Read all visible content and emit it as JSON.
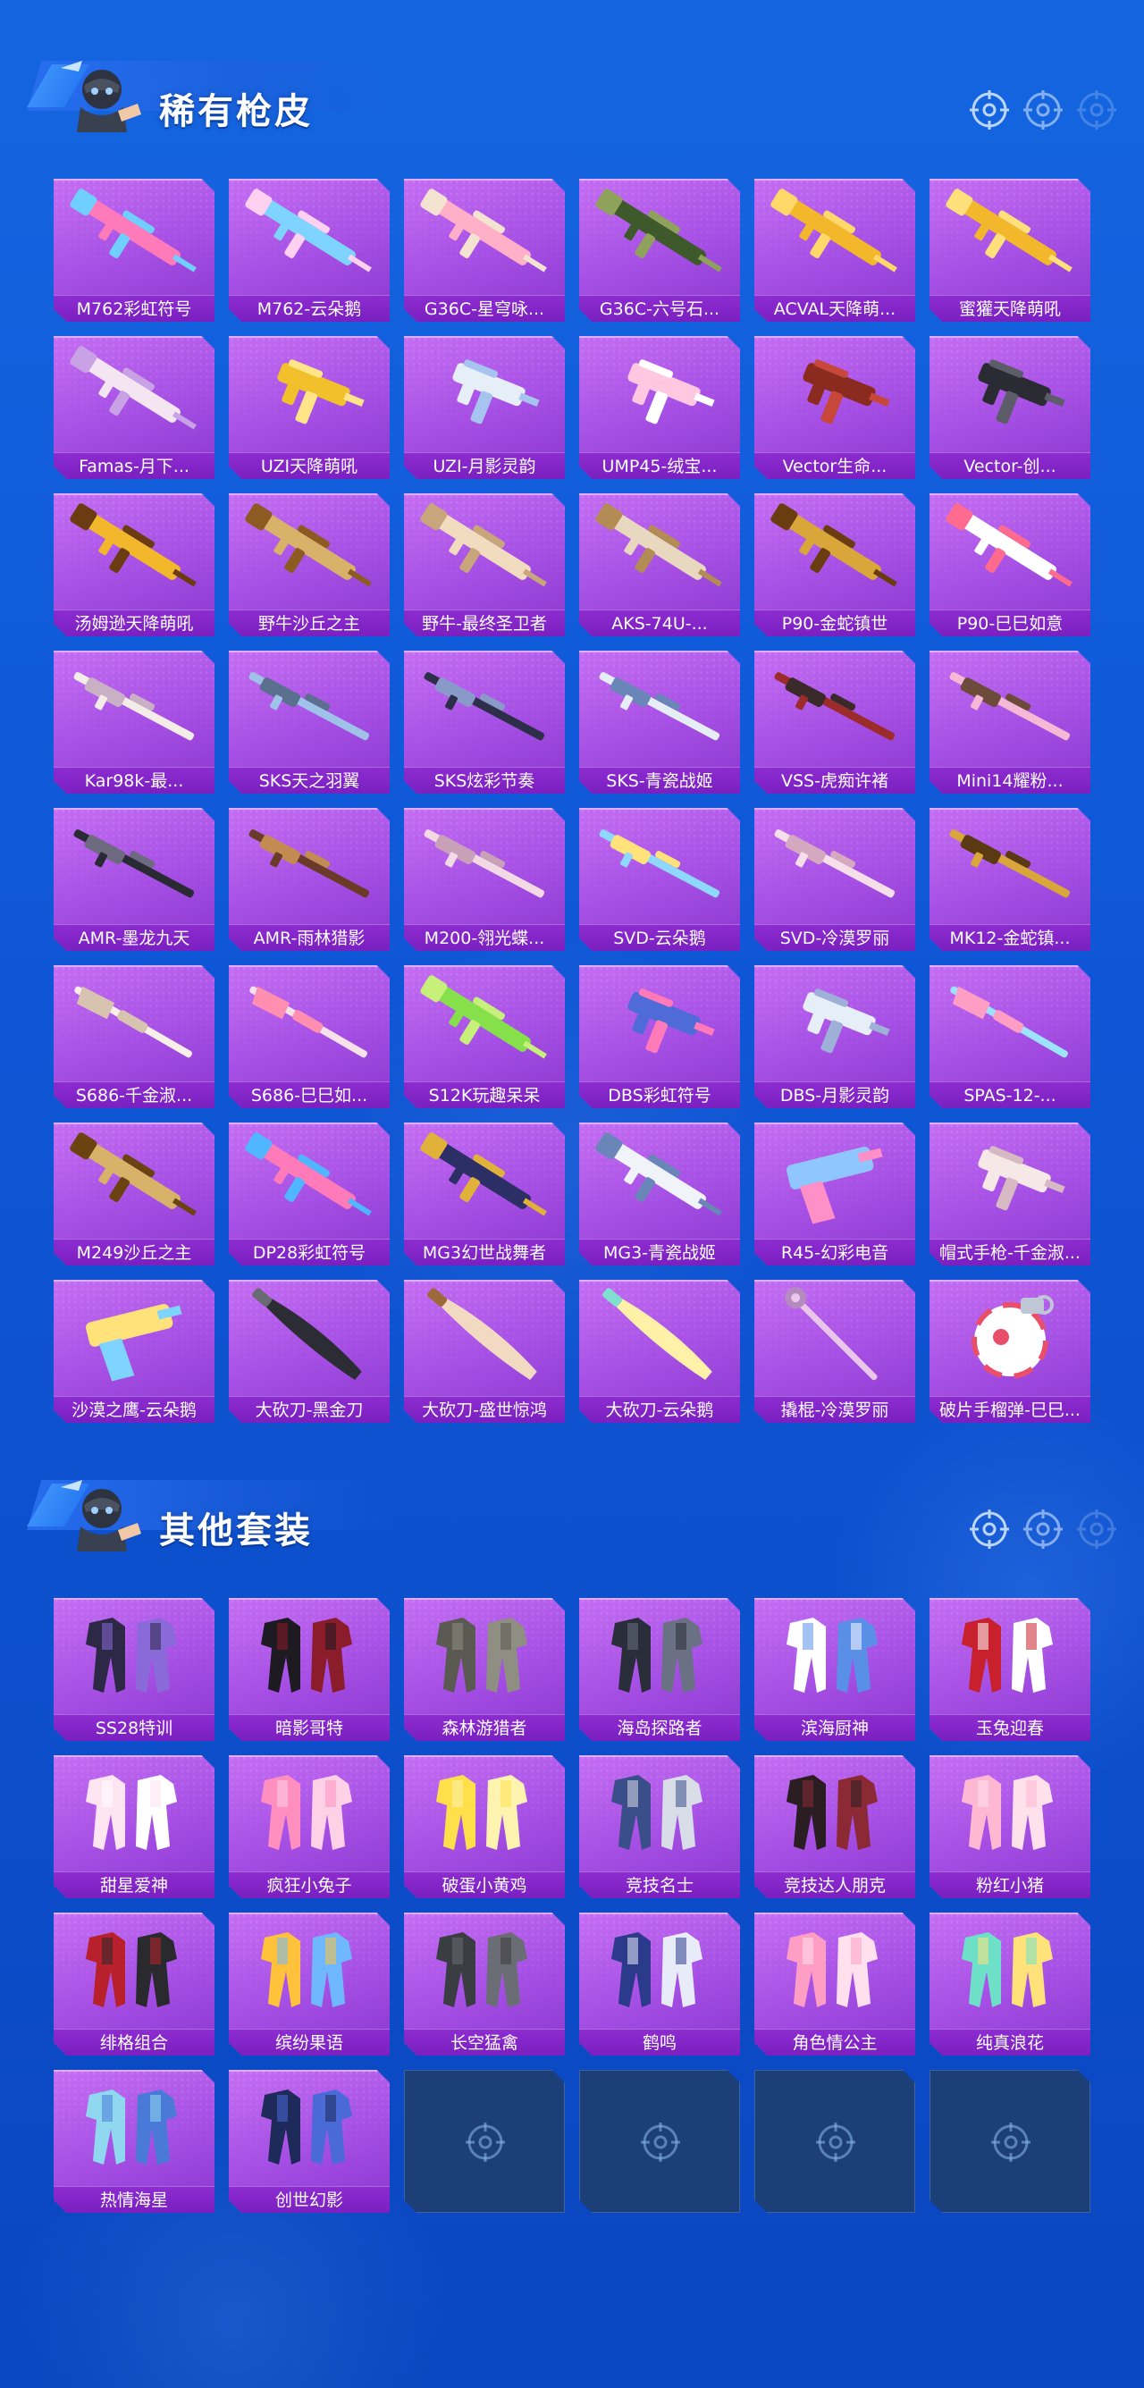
{
  "sections": [
    {
      "title": "稀有枪皮",
      "items": [
        {
          "label": "M762彩虹符号",
          "art": "gun",
          "c1": "#ff7ab8",
          "c2": "#6fd0ff"
        },
        {
          "label": "M762-云朵鹅",
          "art": "gun",
          "c1": "#7fd3ff",
          "c2": "#ffd1f0"
        },
        {
          "label": "G36C-星穹咏...",
          "art": "gun",
          "c1": "#ffb0c8",
          "c2": "#f4e3d0"
        },
        {
          "label": "G36C-六号石...",
          "art": "gun",
          "c1": "#3f5a2a",
          "c2": "#8ea25c"
        },
        {
          "label": "ACVAL天降萌...",
          "art": "gun",
          "c1": "#f2b72a",
          "c2": "#ffd86a"
        },
        {
          "label": "蜜獾天降萌吼",
          "art": "gun",
          "c1": "#f2b72a",
          "c2": "#ffe07a"
        },
        {
          "label": "Famas-月下...",
          "art": "gun",
          "c1": "#f3e6f2",
          "c2": "#c9a2e6"
        },
        {
          "label": "UZI天降萌吼",
          "art": "smg",
          "c1": "#f2c02a",
          "c2": "#ffe488"
        },
        {
          "label": "UZI-月影灵韵",
          "art": "smg",
          "c1": "#e6eef8",
          "c2": "#a7c4f0"
        },
        {
          "label": "UMP45-绒宝...",
          "art": "smg",
          "c1": "#ffc7e0",
          "c2": "#ffffff"
        },
        {
          "label": "Vector生命...",
          "art": "smg",
          "c1": "#8b2a1f",
          "c2": "#c7473a"
        },
        {
          "label": "Vector-创...",
          "art": "smg",
          "c1": "#2b2b33",
          "c2": "#5d5d6a"
        },
        {
          "label": "汤姆逊天降萌吼",
          "art": "gun",
          "c1": "#f2b72a",
          "c2": "#6b3c12"
        },
        {
          "label": "野牛沙丘之主",
          "art": "gun",
          "c1": "#d9b26a",
          "c2": "#8d5a22"
        },
        {
          "label": "野牛-最终圣卫者",
          "art": "gun",
          "c1": "#f1dcc0",
          "c2": "#c8a57a"
        },
        {
          "label": "AKS-74U-...",
          "art": "gun",
          "c1": "#e8d8bf",
          "c2": "#b38b55"
        },
        {
          "label": "P90-金蛇镇世",
          "art": "gun",
          "c1": "#d9a63a",
          "c2": "#6a3d10"
        },
        {
          "label": "P90-巳巳如意",
          "art": "gun",
          "c1": "#ffffff",
          "c2": "#ff6b8f"
        },
        {
          "label": "Kar98k-最...",
          "art": "rifle",
          "c1": "#f4ece6",
          "c2": "#c9b0c4"
        },
        {
          "label": "SKS天之羽翼",
          "art": "rifle",
          "c1": "#9fc2e8",
          "c2": "#5b6f8e"
        },
        {
          "label": "SKS炫彩节奏",
          "art": "rifle",
          "c1": "#2d2f4a",
          "c2": "#8a9ac8"
        },
        {
          "label": "SKS-青瓷战姬",
          "art": "rifle",
          "c1": "#e6eef5",
          "c2": "#6a86b8"
        },
        {
          "label": "VSS-虎痴许褚",
          "art": "rifle",
          "c1": "#9c2b2b",
          "c2": "#3a2a2a"
        },
        {
          "label": "Mini14耀粉...",
          "art": "rifle",
          "c1": "#f5b8d5",
          "c2": "#6d4b3a"
        },
        {
          "label": "AMR-墨龙九天",
          "art": "rifle",
          "c1": "#2a2a34",
          "c2": "#6e6a80"
        },
        {
          "label": "AMR-雨林猎影",
          "art": "rifle",
          "c1": "#6b3b2a",
          "c2": "#c28b52"
        },
        {
          "label": "M200-翎光蝶...",
          "art": "rifle",
          "c1": "#f3d9e4",
          "c2": "#c8a0b8"
        },
        {
          "label": "SVD-云朵鹅",
          "art": "rifle",
          "c1": "#8ed7ff",
          "c2": "#ffe27a"
        },
        {
          "label": "SVD-冷漠罗丽",
          "art": "rifle",
          "c1": "#f6dfe8",
          "c2": "#d4a9bf"
        },
        {
          "label": "MK12-金蛇镇...",
          "art": "rifle",
          "c1": "#d9a63a",
          "c2": "#5a3a12"
        },
        {
          "label": "S686-千金淑...",
          "art": "shotgun",
          "c1": "#f7efe8",
          "c2": "#d8c2b0"
        },
        {
          "label": "S686-巳巳如...",
          "art": "shotgun",
          "c1": "#f8e2ea",
          "c2": "#ff8fb0"
        },
        {
          "label": "S12K玩趣呆呆",
          "art": "gun",
          "c1": "#86e04a",
          "c2": "#c6f07a"
        },
        {
          "label": "DBS彩虹符号",
          "art": "smg",
          "c1": "#4f6bd8",
          "c2": "#ff7ab8"
        },
        {
          "label": "DBS-月影灵韵",
          "art": "smg",
          "c1": "#e6eef8",
          "c2": "#9fb0d8"
        },
        {
          "label": "SPAS-12-...",
          "art": "shotgun",
          "c1": "#9be3ff",
          "c2": "#ff9ec4"
        },
        {
          "label": "M249沙丘之主",
          "art": "gun",
          "c1": "#d9b26a",
          "c2": "#6a4310"
        },
        {
          "label": "DP28彩虹符号",
          "art": "gun",
          "c1": "#ff7ab8",
          "c2": "#4fb6ff"
        },
        {
          "label": "MG3幻世战舞者",
          "art": "gun",
          "c1": "#2b2f66",
          "c2": "#e0b23a"
        },
        {
          "label": "MG3-青瓷战姬",
          "art": "gun",
          "c1": "#f0f3f8",
          "c2": "#6a86b8"
        },
        {
          "label": "R45-幻彩电音",
          "art": "pistol",
          "c1": "#8fc6ff",
          "c2": "#ff8fc7"
        },
        {
          "label": "帽式手枪-千金淑...",
          "art": "smg",
          "c1": "#f5e8e6",
          "c2": "#d6b9c2"
        },
        {
          "label": "沙漠之鹰-云朵鹅",
          "art": "pistol",
          "c1": "#ffe27a",
          "c2": "#7fd3ff"
        },
        {
          "label": "大砍刀-黑金刀",
          "art": "blade",
          "c1": "#2c2c34",
          "c2": "#6a6a74"
        },
        {
          "label": "大砍刀-盛世惊鸿",
          "art": "blade",
          "c1": "#f2d9c2",
          "c2": "#9c6a3a"
        },
        {
          "label": "大砍刀-云朵鹅",
          "art": "blade",
          "c1": "#fff2a8",
          "c2": "#7fe0d0"
        },
        {
          "label": "撬棍-冷漠罗丽",
          "art": "staff",
          "c1": "#e9c7e8",
          "c2": "#b58ac0"
        },
        {
          "label": "破片手榴弹-巳巳...",
          "art": "grenade",
          "c1": "#ffffff",
          "c2": "#e94f6a"
        }
      ]
    },
    {
      "title": "其他套装",
      "items": [
        {
          "label": "SS28特训",
          "art": "suit",
          "c1": "#2c2846",
          "c2": "#8a6ad8"
        },
        {
          "label": "暗影哥特",
          "art": "suit",
          "c1": "#1d1a22",
          "c2": "#8b1c2a"
        },
        {
          "label": "森林游猎者",
          "art": "suit",
          "c1": "#5a5a52",
          "c2": "#8e8e82"
        },
        {
          "label": "海岛探路者",
          "art": "suit",
          "c1": "#2a2e3a",
          "c2": "#6a7184"
        },
        {
          "label": "滨海厨神",
          "art": "suit",
          "c1": "#ffffff",
          "c2": "#5a8fe8"
        },
        {
          "label": "玉兔迎春",
          "art": "suit",
          "c1": "#c8202c",
          "c2": "#ffffff"
        },
        {
          "label": "甜星爱神",
          "art": "suit",
          "c1": "#ffe4f2",
          "c2": "#ffffff"
        },
        {
          "label": "疯狂小兔子",
          "art": "suit",
          "c1": "#ff8fbf",
          "c2": "#ffd1e6"
        },
        {
          "label": "破蛋小黄鸡",
          "art": "suit",
          "c1": "#ffe04a",
          "c2": "#fff3b0"
        },
        {
          "label": "竞技名士",
          "art": "suit",
          "c1": "#3a4e8a",
          "c2": "#d8dde8"
        },
        {
          "label": "竞技达人朋克",
          "art": "suit",
          "c1": "#2a1e22",
          "c2": "#8b2a34"
        },
        {
          "label": "粉红小猪",
          "art": "suit",
          "c1": "#ffb8d2",
          "c2": "#ffe1ec"
        },
        {
          "label": "绯格组合",
          "art": "suit",
          "c1": "#b8202c",
          "c2": "#2a2a2e"
        },
        {
          "label": "缤纷果语",
          "art": "suit",
          "c1": "#ffc23a",
          "c2": "#6fb8ff"
        },
        {
          "label": "长空猛禽",
          "art": "suit",
          "c1": "#3a3d42",
          "c2": "#6a6e74"
        },
        {
          "label": "鹤鸣",
          "art": "suit",
          "c1": "#2b3a8a",
          "c2": "#e8ecf8"
        },
        {
          "label": "角色情公主",
          "art": "suit",
          "c1": "#ff9ec4",
          "c2": "#ffe0ec"
        },
        {
          "label": "纯真浪花",
          "art": "suit",
          "c1": "#6fe0c8",
          "c2": "#ffe27a"
        },
        {
          "label": "热情海星",
          "art": "suit",
          "c1": "#8fd8f0",
          "c2": "#4a7ad8"
        },
        {
          "label": "创世幻影",
          "art": "suit",
          "c1": "#1e2a5a",
          "c2": "#4a6ad8"
        },
        {
          "empty": true
        },
        {
          "empty": true
        },
        {
          "empty": true
        },
        {
          "empty": true
        }
      ]
    }
  ],
  "colors": {
    "card_purple": "#a44ee4",
    "label_bar": "#7a1fc0",
    "empty_slot": "#1d3f78",
    "background": "#0f58d8"
  },
  "icons": {
    "header_mascot": "masked-soldier-icon",
    "header_decor": "crosshair-icon",
    "empty_slot": "crosshair-icon"
  }
}
